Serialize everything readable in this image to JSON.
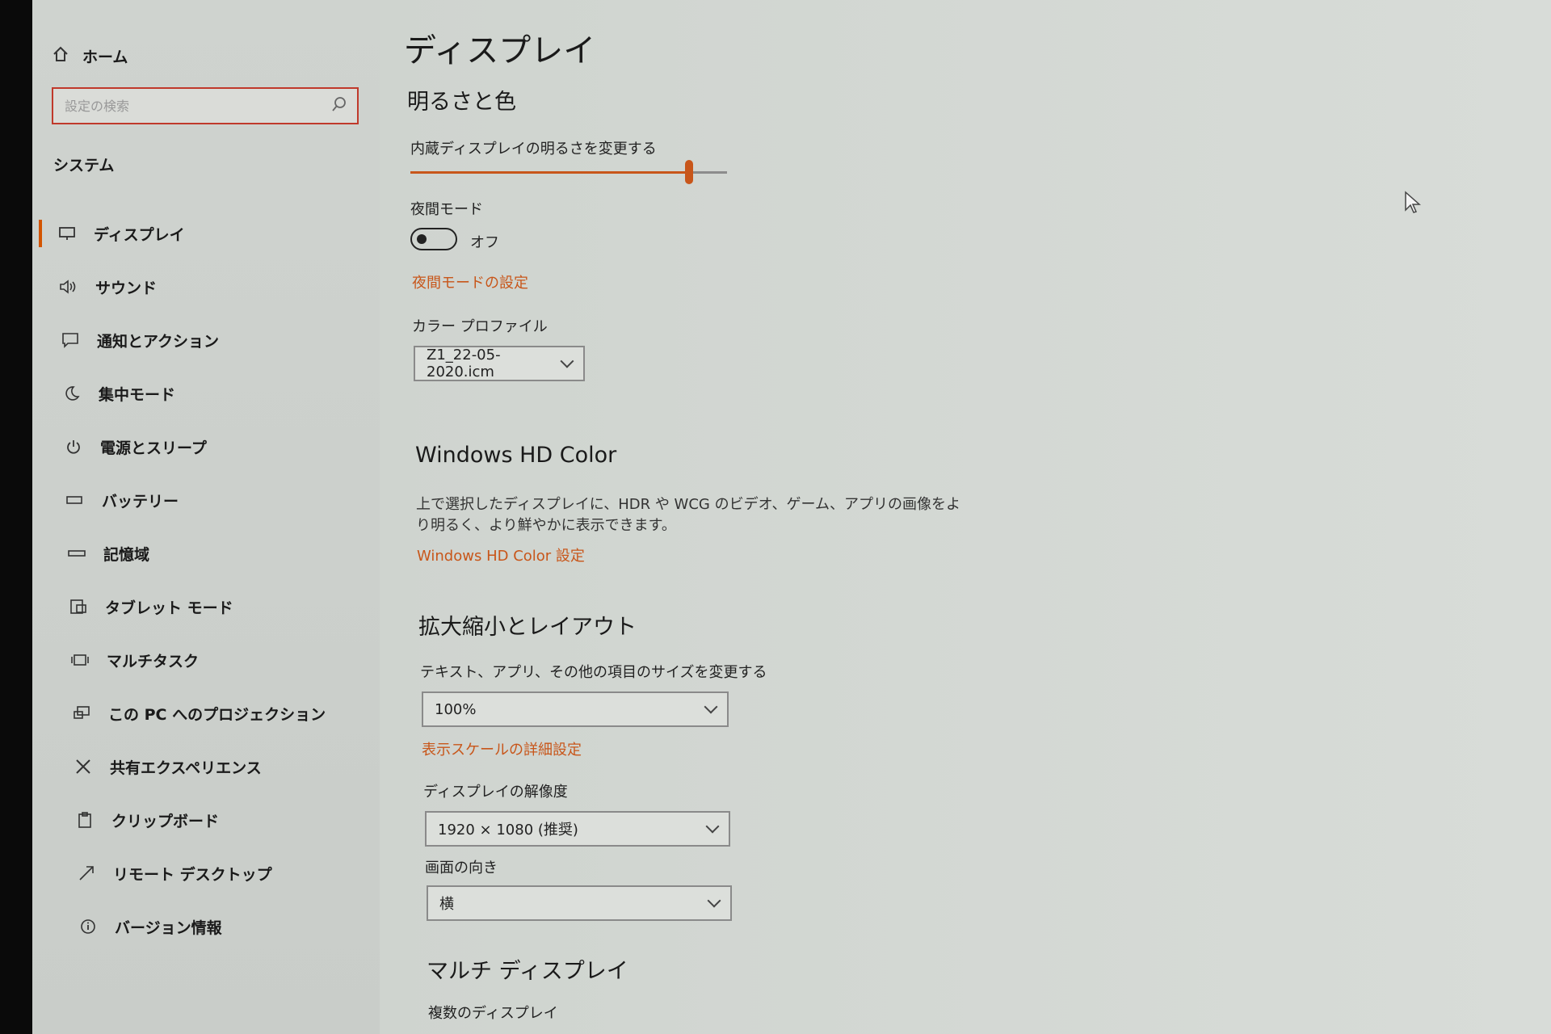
{
  "sidebar": {
    "home_label": "ホーム",
    "search_placeholder": "設定の検索",
    "section_label": "システム",
    "items": [
      {
        "label": "ディスプレイ",
        "icon": "monitor-icon",
        "active": true
      },
      {
        "label": "サウンド",
        "icon": "speaker-icon"
      },
      {
        "label": "通知とアクション",
        "icon": "notification-icon"
      },
      {
        "label": "集中モード",
        "icon": "moon-icon"
      },
      {
        "label": "電源とスリープ",
        "icon": "power-icon"
      },
      {
        "label": "バッテリー",
        "icon": "battery-icon"
      },
      {
        "label": "記憶域",
        "icon": "storage-icon"
      },
      {
        "label": "タブレット モード",
        "icon": "tablet-icon"
      },
      {
        "label": "マルチタスク",
        "icon": "multitask-icon"
      },
      {
        "label": "この PC へのプロジェクション",
        "icon": "projection-icon"
      },
      {
        "label": "共有エクスペリエンス",
        "icon": "shared-icon"
      },
      {
        "label": "クリップボード",
        "icon": "clipboard-icon"
      },
      {
        "label": "リモート デスクトップ",
        "icon": "remote-desktop-icon"
      },
      {
        "label": "バージョン情報",
        "icon": "info-icon"
      }
    ]
  },
  "main": {
    "title": "ディスプレイ",
    "brightness": {
      "heading": "明るさと色",
      "slider_label": "内蔵ディスプレイの明るさを変更する",
      "level_percent": 88,
      "night_mode_label": "夜間モード",
      "night_mode_state": "オフ",
      "night_mode_link": "夜間モードの設定",
      "color_profile_label": "カラー プロファイル",
      "color_profile_value": "Z1_22-05-2020.icm"
    },
    "hd_color": {
      "heading": "Windows HD Color",
      "description": "上で選択したディスプレイに、HDR や WCG のビデオ、ゲーム、アプリの画像をより明るく、より鮮やかに表示できます。",
      "link": "Windows HD Color 設定"
    },
    "scale": {
      "heading": "拡大縮小とレイアウト",
      "size_label": "テキスト、アプリ、その他の項目のサイズを変更する",
      "size_value": "100%",
      "advanced_link": "表示スケールの詳細設定",
      "resolution_label": "ディスプレイの解像度",
      "resolution_value": "1920 × 1080 (推奨)",
      "orientation_label": "画面の向き",
      "orientation_value": "横"
    },
    "multi": {
      "heading": "マルチ ディスプレイ",
      "label": "複数のディスプレイ"
    }
  },
  "colors": {
    "accent": "#c8561a",
    "search_border": "#c0392b"
  }
}
